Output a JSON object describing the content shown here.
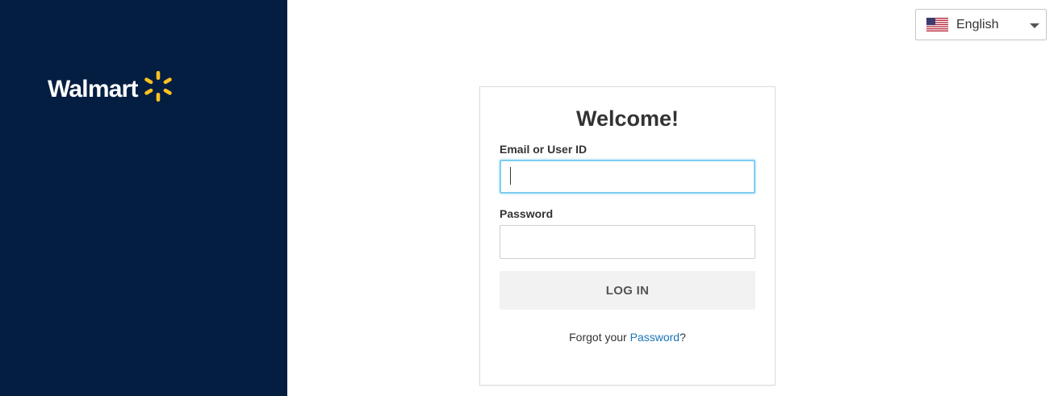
{
  "brand": {
    "name": "Walmart",
    "background_color": "#041e42",
    "spark_color": "#ffc220"
  },
  "language": {
    "selected": "English",
    "flag_icon": "us-flag-icon"
  },
  "login_card": {
    "title": "Welcome!",
    "email_label": "Email or User ID",
    "email_value": "",
    "password_label": "Password",
    "password_value": "",
    "login_button": "LOG IN",
    "forgot_prefix": "Forgot your ",
    "forgot_link": "Password",
    "forgot_suffix": "?"
  },
  "colors": {
    "link": "#1a75b8",
    "focus_border": "#7fcdf0",
    "button_bg": "#f2f2f2"
  }
}
